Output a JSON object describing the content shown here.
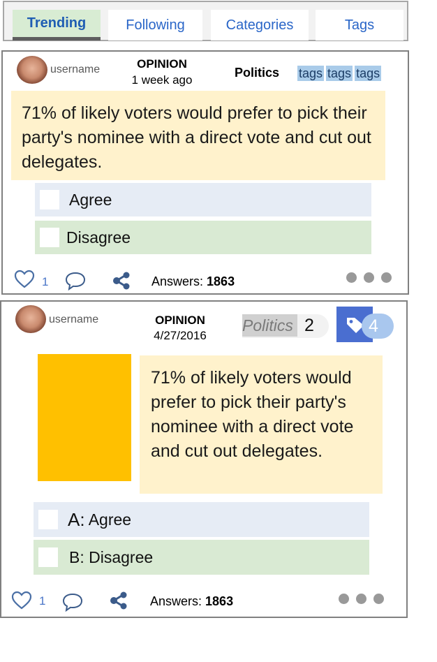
{
  "tabs": [
    {
      "label": "Trending",
      "active": true
    },
    {
      "label": "Following",
      "active": false
    },
    {
      "label": "Categories",
      "active": false
    },
    {
      "label": "Tags",
      "active": false
    }
  ],
  "card1": {
    "username": "username",
    "type": "OPINION",
    "time": "1 week ago",
    "category": "Politics",
    "tags": [
      "tags",
      "tags",
      "tags"
    ],
    "question": "71% of likely voters would prefer to pick their party's nominee with a direct vote and cut out delegates.",
    "options": [
      {
        "label": "Agree"
      },
      {
        "label": "Disagree"
      }
    ],
    "likes": "1",
    "answers_label": "Answers: ",
    "answers_count": "1863"
  },
  "card2": {
    "username": "username",
    "type": "OPINION",
    "date": "4/27/2016",
    "category": "Politics",
    "category_count": "2",
    "tag_count": "4",
    "question": "71% of likely voters would prefer to pick their party's nominee with a direct vote and cut out delegates.",
    "options": [
      {
        "letter": "A:",
        "label": " Agree"
      },
      {
        "letter": "B:",
        "label": " Disagree"
      }
    ],
    "likes": "1",
    "answers_label": "Answers: ",
    "answers_count": "1863"
  },
  "colors": {
    "tab_active_bg": "#d8ecd3",
    "tab_text": "#2a66c8",
    "question_bg": "#fff2cc",
    "option_a_bg": "#e6ecf5",
    "option_b_bg": "#d9ead3",
    "tag_bg": "#a9cbe9",
    "image_placeholder": "#ffc000",
    "tag_button_bg": "#4a6ed0"
  },
  "icons": [
    "heart-icon",
    "comment-icon",
    "share-icon",
    "more-icon",
    "tag-icon"
  ]
}
